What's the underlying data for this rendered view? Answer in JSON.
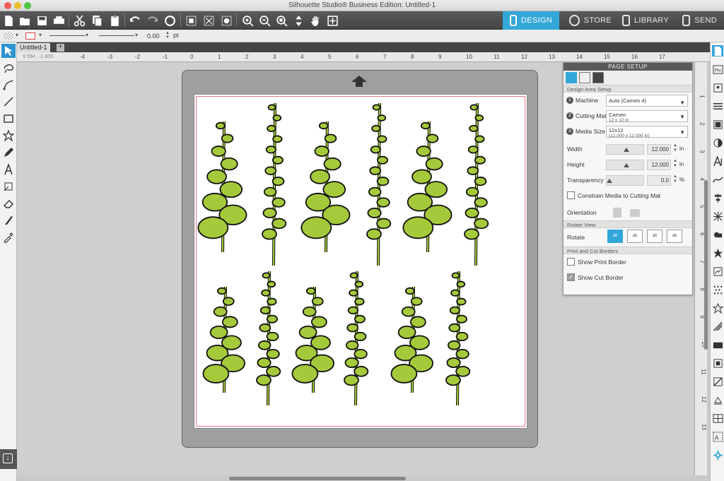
{
  "window": {
    "title": "Silhouette Studio® Business Edition: Untitled-1"
  },
  "nav": {
    "design": "DESIGN",
    "store": "STORE",
    "library": "LIBRARY",
    "send": "SEND"
  },
  "propbar": {
    "line_width": "0.00",
    "unit": "pt"
  },
  "document": {
    "tab": "Untitled-1",
    "add": "+",
    "coords": "9.594 , -1.805"
  },
  "ruler": {
    "h": [
      "-4",
      "-3",
      "-2",
      "-1",
      "0",
      "1",
      "2",
      "3",
      "4",
      "5",
      "6",
      "7",
      "8",
      "9",
      "10",
      "11",
      "12",
      "13",
      "14",
      "15",
      "16",
      "17"
    ],
    "v": [
      "1",
      "2",
      "3",
      "4",
      "5",
      "6",
      "7",
      "8",
      "9",
      "10",
      "11",
      "12",
      "13"
    ]
  },
  "panel": {
    "title": "PAGE SETUP",
    "design_area_section": "Design Area Setup",
    "machine": {
      "num": "1",
      "label": "Machine",
      "value": "Auto (Cameo 4)"
    },
    "cutting_mat": {
      "num": "2",
      "label": "Cutting Mat",
      "value": "Cameo",
      "sub": "12 x 12 in"
    },
    "media_size": {
      "num": "3",
      "label": "Media Size",
      "value": "12x12",
      "sub": "(12.000 x 12.000 in)"
    },
    "width": {
      "label": "Width",
      "value": "12.000",
      "unit": "in"
    },
    "height": {
      "label": "Height",
      "value": "12.000",
      "unit": "in"
    },
    "transparency": {
      "label": "Transparency",
      "value": "0.0",
      "unit": "%"
    },
    "constrain": "Constrain Media to Cutting Mat",
    "orientation": "Orientation",
    "rotate_section": "Rotate View",
    "rotate": "Rotate",
    "rotate_opts": [
      "ab",
      "ab",
      "ab",
      "ab"
    ],
    "print_cut_section": "Print and Cut Borders",
    "show_print_border": "Show Print Border",
    "show_cut_border": "Show Cut Border",
    "check_mark": "✓"
  },
  "colors": {
    "accent": "#33a7d8",
    "leaf": "#a4c93b",
    "outline": "#111111",
    "cut_border": "#e07a86"
  }
}
